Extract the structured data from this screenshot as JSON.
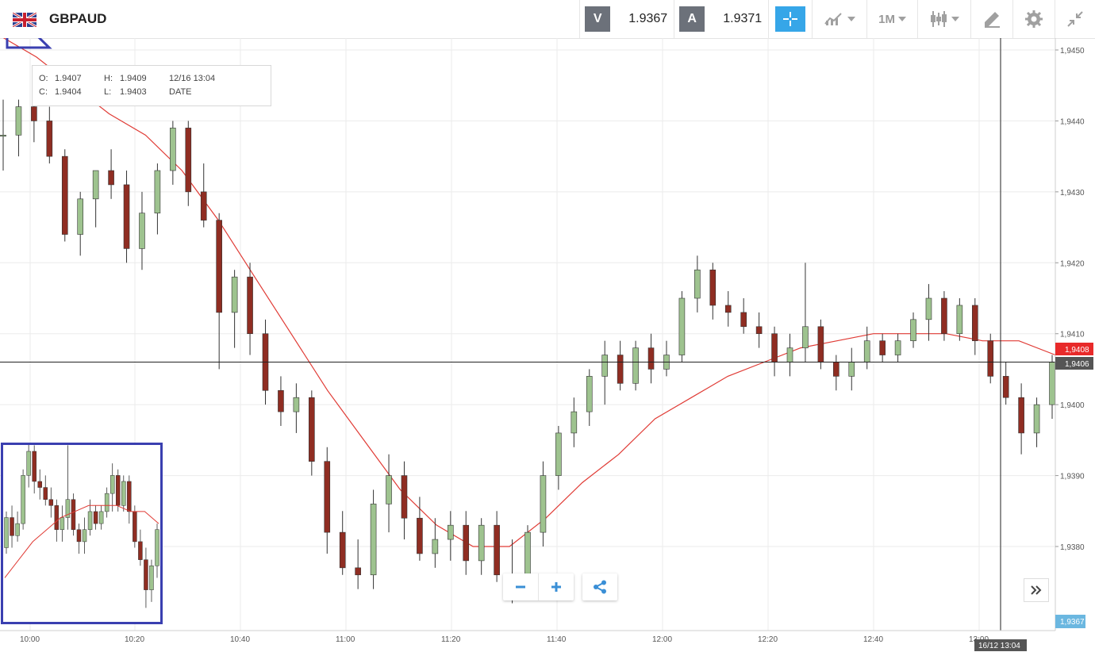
{
  "header": {
    "symbol": "GBPAUD",
    "sell_label": "V",
    "sell_price": "1.9367",
    "buy_label": "A",
    "buy_price": "1.9371",
    "timeframe": "1M"
  },
  "ohlc": {
    "o_label": "O:",
    "o_val": "1.9407",
    "h_label": "H:",
    "h_val": "1.9409",
    "c_label": "C:",
    "c_val": "1.9404",
    "l_label": "L:",
    "l_val": "1.9403",
    "datetime": "12/16 13:04",
    "date_label": "DATE"
  },
  "colors": {
    "up": "#9ec38f",
    "down": "#8f2d22",
    "ma": "#e03b35",
    "grid": "#ebebeb",
    "accent": "#36a6e8",
    "price_tag": "#e82a2a"
  },
  "chart_data": {
    "type": "candlestick",
    "xlabels": [
      "10:00",
      "10:20",
      "10:40",
      "11:00",
      "11:20",
      "11:40",
      "12:00",
      "12:20",
      "12:40",
      "13:00"
    ],
    "yticks": [
      "1,9450",
      "1,9440",
      "1,9430",
      "1,9420",
      "1,9410",
      "1,9400",
      "1,9390",
      "1,9380"
    ],
    "ylim": [
      1.9371,
      1.9456
    ],
    "current_price_label": "1,9408",
    "crosshair_price_label": "1,9406",
    "crosshair_time_label": "16/12 13:04",
    "bid_label": "1,9367",
    "ma": [
      1.9452,
      1.9449,
      1.9445,
      1.9441,
      1.9438,
      1.9433,
      1.9426,
      1.9418,
      1.941,
      1.9402,
      1.9395,
      1.9388,
      1.9383,
      1.938,
      1.938,
      1.9384,
      1.9389,
      1.9393,
      1.9398,
      1.9401,
      1.9404,
      1.9406,
      1.9408,
      1.9409,
      1.941,
      1.941,
      1.941,
      1.9409,
      1.9409,
      1.9407
    ],
    "candles": [
      [
        1.9438,
        1.9443,
        1.9433,
        1.9438
      ],
      [
        1.9438,
        1.9443,
        1.9435,
        1.9442
      ],
      [
        1.9442,
        1.9444,
        1.9437,
        1.944
      ],
      [
        1.944,
        1.9442,
        1.9434,
        1.9435
      ],
      [
        1.9435,
        1.9436,
        1.9423,
        1.9424
      ],
      [
        1.9424,
        1.943,
        1.9421,
        1.9429
      ],
      [
        1.9429,
        1.9433,
        1.9425,
        1.9433
      ],
      [
        1.9433,
        1.9436,
        1.9429,
        1.9431
      ],
      [
        1.9431,
        1.9433,
        1.942,
        1.9422
      ],
      [
        1.9422,
        1.943,
        1.9419,
        1.9427
      ],
      [
        1.9427,
        1.9434,
        1.9424,
        1.9433
      ],
      [
        1.9433,
        1.944,
        1.9431,
        1.9439
      ],
      [
        1.9439,
        1.944,
        1.9428,
        1.943
      ],
      [
        1.943,
        1.9434,
        1.9425,
        1.9426
      ],
      [
        1.9426,
        1.9427,
        1.9405,
        1.9413
      ],
      [
        1.9413,
        1.9419,
        1.9408,
        1.9418
      ],
      [
        1.9418,
        1.942,
        1.9407,
        1.941
      ],
      [
        1.941,
        1.9412,
        1.94,
        1.9402
      ],
      [
        1.9402,
        1.9404,
        1.9397,
        1.9399
      ],
      [
        1.9399,
        1.9403,
        1.9396,
        1.9401
      ],
      [
        1.9401,
        1.9402,
        1.939,
        1.9392
      ],
      [
        1.9392,
        1.9394,
        1.9379,
        1.9382
      ],
      [
        1.9382,
        1.9385,
        1.9376,
        1.9377
      ],
      [
        1.9377,
        1.9381,
        1.9374,
        1.9376
      ],
      [
        1.9376,
        1.9388,
        1.9374,
        1.9386
      ],
      [
        1.9386,
        1.9393,
        1.9382,
        1.939
      ],
      [
        1.939,
        1.9392,
        1.9381,
        1.9384
      ],
      [
        1.9384,
        1.9387,
        1.9378,
        1.9379
      ],
      [
        1.9379,
        1.9384,
        1.9377,
        1.9381
      ],
      [
        1.9381,
        1.9385,
        1.9378,
        1.9383
      ],
      [
        1.9383,
        1.9385,
        1.9376,
        1.9378
      ],
      [
        1.9378,
        1.9384,
        1.9376,
        1.9383
      ],
      [
        1.9383,
        1.9385,
        1.9375,
        1.9376
      ],
      [
        1.9376,
        1.9381,
        1.9372,
        1.9375
      ],
      [
        1.9375,
        1.9383,
        1.9374,
        1.9382
      ],
      [
        1.9382,
        1.9392,
        1.938,
        1.939
      ],
      [
        1.939,
        1.9397,
        1.9388,
        1.9396
      ],
      [
        1.9396,
        1.9401,
        1.9394,
        1.9399
      ],
      [
        1.9399,
        1.9405,
        1.9397,
        1.9404
      ],
      [
        1.9404,
        1.9409,
        1.94,
        1.9407
      ],
      [
        1.9407,
        1.9409,
        1.9402,
        1.9403
      ],
      [
        1.9403,
        1.9409,
        1.9402,
        1.9408
      ],
      [
        1.9408,
        1.941,
        1.9403,
        1.9405
      ],
      [
        1.9405,
        1.9409,
        1.9404,
        1.9407
      ],
      [
        1.9407,
        1.9416,
        1.9406,
        1.9415
      ],
      [
        1.9415,
        1.9421,
        1.9413,
        1.9419
      ],
      [
        1.9419,
        1.942,
        1.9412,
        1.9414
      ],
      [
        1.9414,
        1.9416,
        1.9411,
        1.9413
      ],
      [
        1.9413,
        1.9415,
        1.941,
        1.9411
      ],
      [
        1.9411,
        1.9413,
        1.9408,
        1.941
      ],
      [
        1.941,
        1.9411,
        1.9404,
        1.9406
      ],
      [
        1.9406,
        1.941,
        1.9404,
        1.9408
      ],
      [
        1.9408,
        1.942,
        1.9406,
        1.9411
      ],
      [
        1.9411,
        1.9412,
        1.9405,
        1.9406
      ],
      [
        1.9406,
        1.9407,
        1.9402,
        1.9404
      ],
      [
        1.9404,
        1.9408,
        1.9402,
        1.9406
      ],
      [
        1.9406,
        1.9411,
        1.9405,
        1.9409
      ],
      [
        1.9409,
        1.941,
        1.9406,
        1.9407
      ],
      [
        1.9407,
        1.941,
        1.9406,
        1.9409
      ],
      [
        1.9409,
        1.9413,
        1.9408,
        1.9412
      ],
      [
        1.9412,
        1.9417,
        1.9409,
        1.9415
      ],
      [
        1.9415,
        1.9416,
        1.9409,
        1.941
      ],
      [
        1.941,
        1.9415,
        1.9409,
        1.9414
      ],
      [
        1.9414,
        1.9415,
        1.9407,
        1.9409
      ],
      [
        1.9409,
        1.941,
        1.9403,
        1.9404
      ],
      [
        1.9404,
        1.9406,
        1.94,
        1.9401
      ],
      [
        1.9401,
        1.9403,
        1.9393,
        1.9396
      ],
      [
        1.9396,
        1.9401,
        1.9394,
        1.94
      ],
      [
        1.94,
        1.9407,
        1.9398,
        1.9406
      ]
    ]
  }
}
